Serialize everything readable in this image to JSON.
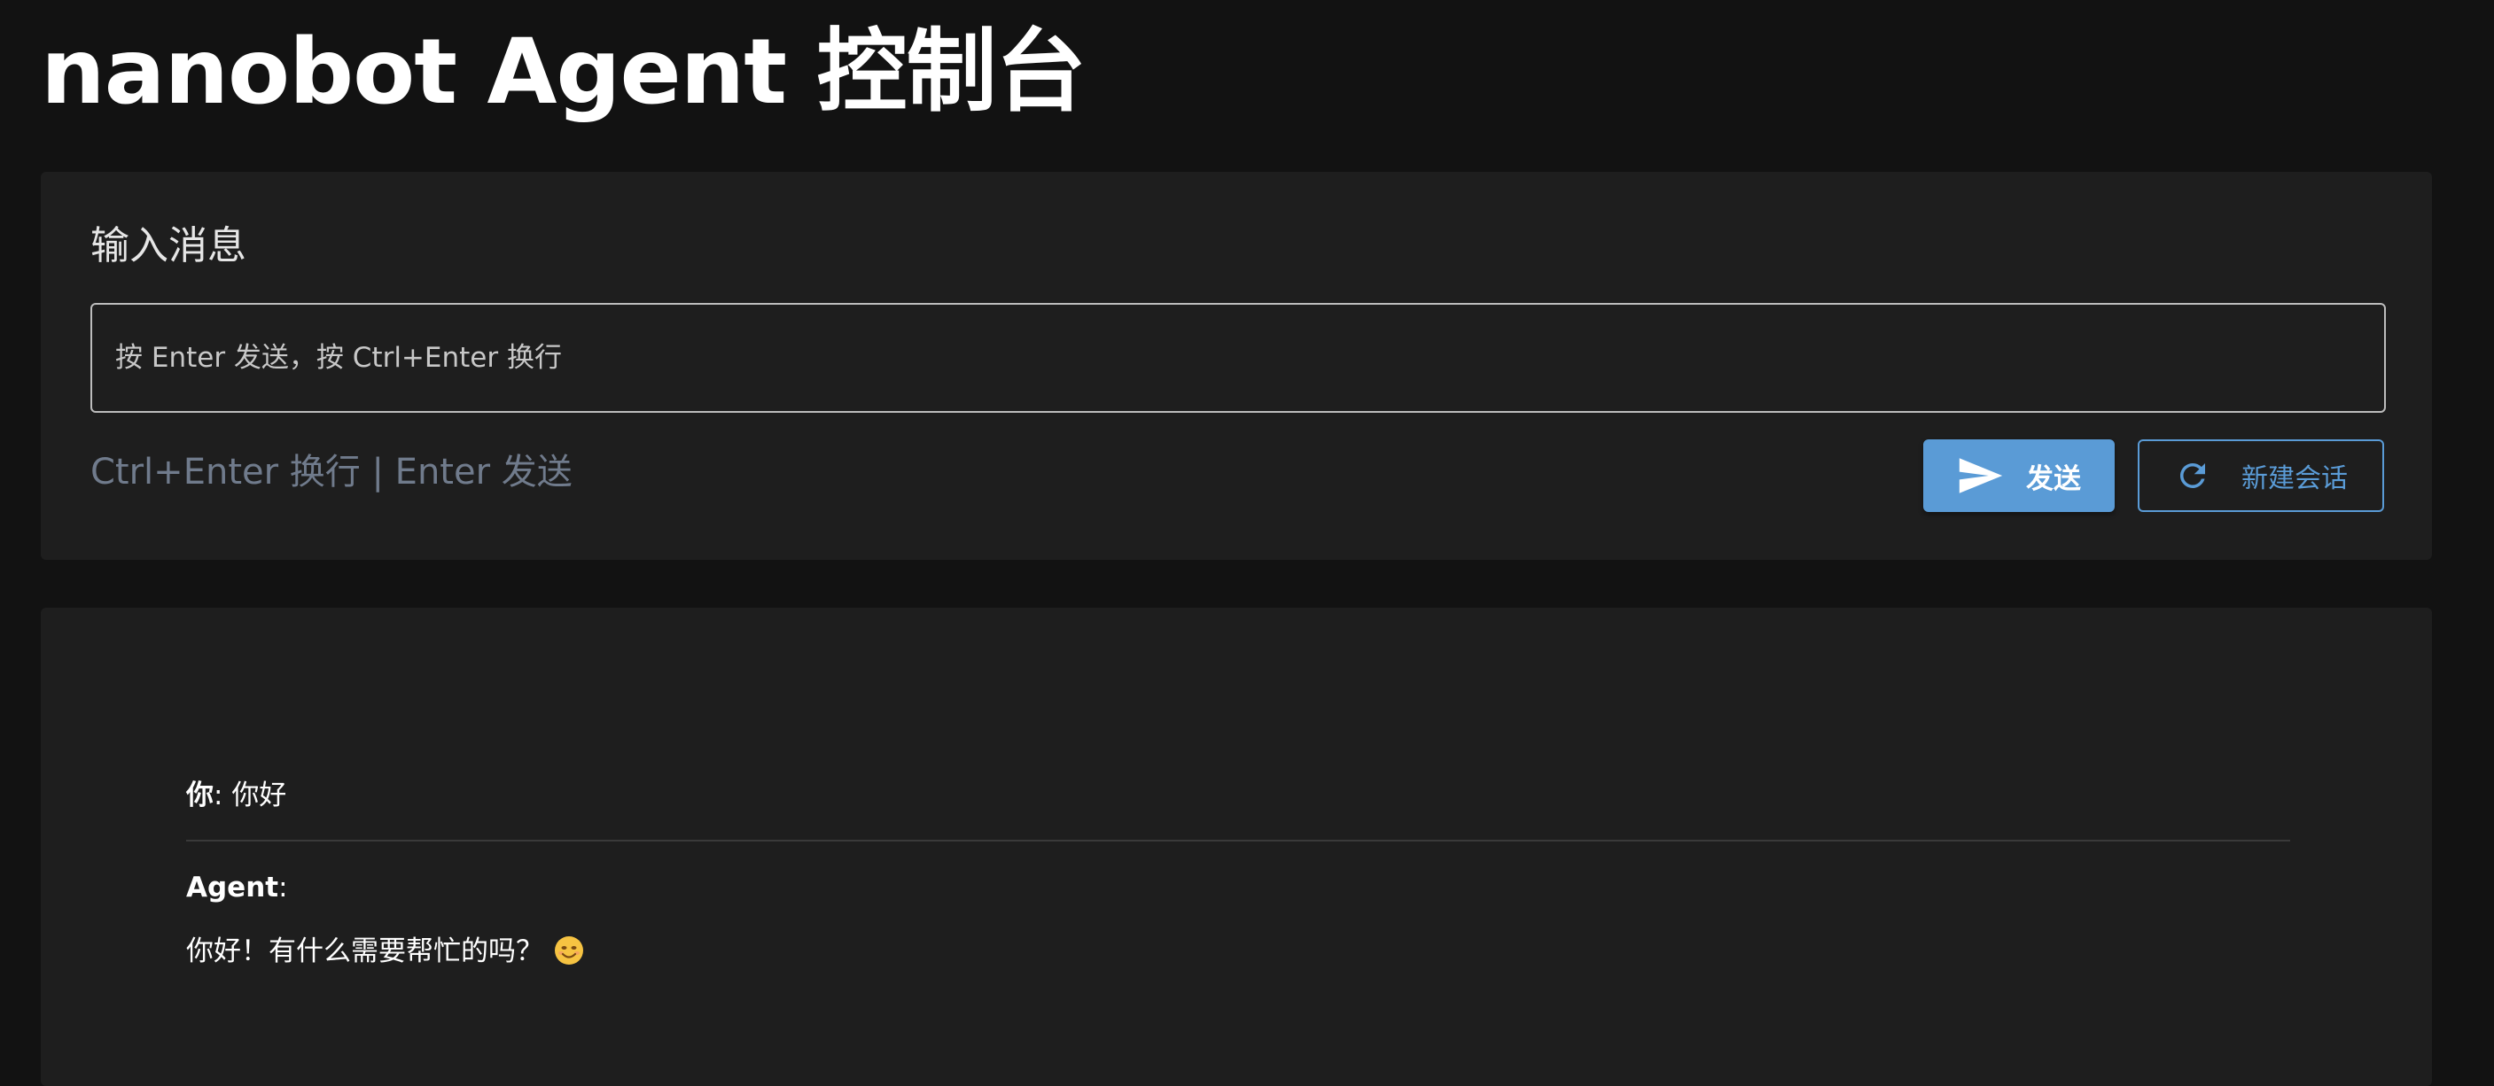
{
  "page": {
    "title": "nanobot Agent 控制台"
  },
  "input_panel": {
    "heading": "输入消息",
    "placeholder": "按 Enter 发送，按 Ctrl+Enter 换行",
    "value": "",
    "hint": "Ctrl+Enter 换行 | Enter 发送",
    "send_label": "发送",
    "send_icon": "send-icon",
    "new_session_label": "新建会话",
    "new_session_icon": "refresh-icon"
  },
  "chat": {
    "messages": [
      {
        "sender": "你",
        "separator": ": ",
        "text": "你好"
      },
      {
        "sender": "Agent",
        "separator": ":",
        "text": "你好！有什么需要帮忙的吗？",
        "emoji": "smiling-face-emoji"
      }
    ]
  },
  "colors": {
    "background": "#121212",
    "card": "#1e1e1e",
    "accent": "#5a9bd6",
    "hint": "#707b8c"
  }
}
